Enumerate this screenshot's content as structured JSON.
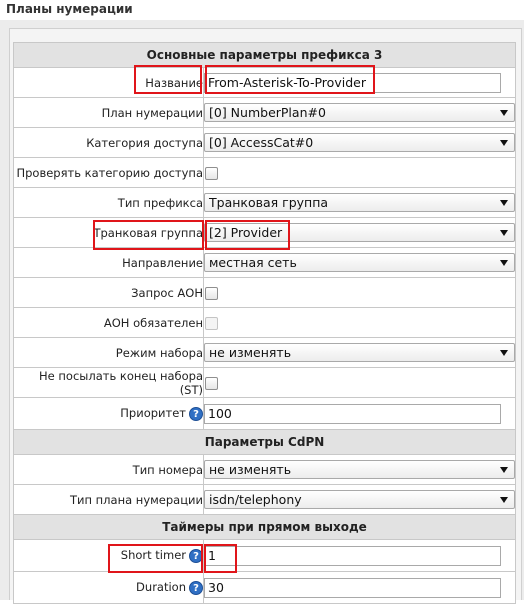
{
  "page": {
    "title": "Планы нумерации"
  },
  "sections": {
    "main": "Основные параметры префикса 3",
    "cdpn": "Параметры CdPN",
    "timers": "Таймеры при прямом выходе"
  },
  "fields": {
    "name": {
      "label": "Название",
      "value": "From-Asterisk-To-Provider"
    },
    "numbering_plan": {
      "label": "План нумерации",
      "value": "[0] NumberPlan#0"
    },
    "access_category": {
      "label": "Категория доступа",
      "value": "[0] AccessCat#0"
    },
    "check_access_category": {
      "label": "Проверять категорию доступа",
      "checked": false
    },
    "prefix_type": {
      "label": "Тип префикса",
      "value": "Транковая группа"
    },
    "trunk_group": {
      "label": "Транковая группа",
      "value": "[2] Provider"
    },
    "direction": {
      "label": "Направление",
      "value": "местная сеть"
    },
    "aon_request": {
      "label": "Запрос АОН",
      "checked": false
    },
    "aon_required": {
      "label": "АОН обязателен",
      "checked": false,
      "disabled": true
    },
    "dial_mode": {
      "label": "Режим набора",
      "value": "не изменять"
    },
    "no_st": {
      "label": "Не посылать конец набора (ST)",
      "checked": false
    },
    "priority": {
      "label": "Приоритет",
      "value": "100"
    },
    "number_type": {
      "label": "Тип номера",
      "value": "не изменять"
    },
    "numbering_plan_type": {
      "label": "Тип плана нумерации",
      "value": "isdn/telephony"
    },
    "short_timer": {
      "label": "Short timer",
      "value": "1"
    },
    "duration": {
      "label": "Duration",
      "value": "30"
    }
  },
  "help_icon_glyph": "?",
  "colors": {
    "highlight": "#e0151a",
    "section_bg": "#e2e2e2",
    "help_icon": "#2f6fc4"
  }
}
